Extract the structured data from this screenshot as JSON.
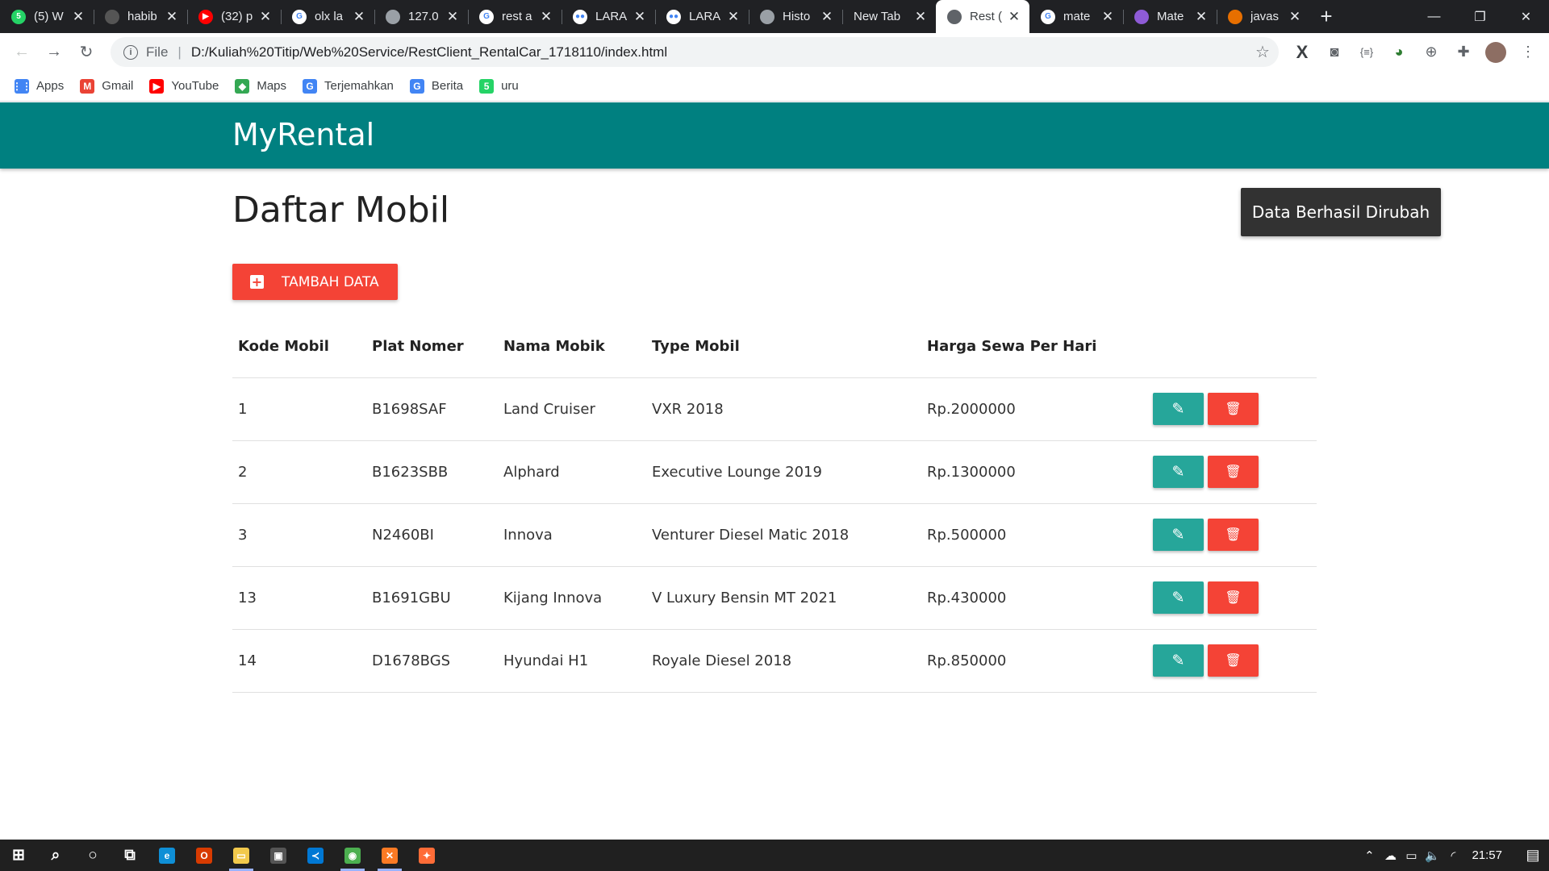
{
  "browser": {
    "tabs": [
      {
        "title": "(5) W",
        "favicon": "whatsapp-icon",
        "color": "#25d366",
        "glyph": "5",
        "active": false
      },
      {
        "title": "habib",
        "favicon": "github-icon",
        "color": "#555555",
        "glyph": "",
        "active": false
      },
      {
        "title": "(32) p",
        "favicon": "youtube-icon",
        "color": "#ff0000",
        "glyph": "▶",
        "active": false
      },
      {
        "title": "olx la",
        "favicon": "google-icon",
        "color": "#ffffff",
        "glyph": "G",
        "active": false
      },
      {
        "title": "127.0",
        "favicon": "globe-icon",
        "color": "#9aa0a6",
        "glyph": "",
        "active": false
      },
      {
        "title": "rest a",
        "favicon": "google-icon",
        "color": "#ffffff",
        "glyph": "G",
        "active": false
      },
      {
        "title": "LARA",
        "favicon": "medium-icon",
        "color": "#ffffff",
        "glyph": "●●",
        "active": false
      },
      {
        "title": "LARA",
        "favicon": "medium-icon",
        "color": "#ffffff",
        "glyph": "●●",
        "active": false
      },
      {
        "title": "Histo",
        "favicon": "history-icon",
        "color": "#9aa0a6",
        "glyph": "",
        "active": false
      },
      {
        "title": "New Tab",
        "favicon": "",
        "color": "",
        "glyph": "",
        "active": false
      },
      {
        "title": "Rest (",
        "favicon": "globe-icon",
        "color": "#5f6368",
        "glyph": "",
        "active": true
      },
      {
        "title": "mate",
        "favicon": "google-icon",
        "color": "#ffffff",
        "glyph": "G",
        "active": false
      },
      {
        "title": "Mate",
        "favicon": "materialize-icon",
        "color": "#8e5bd6",
        "glyph": "",
        "active": false
      },
      {
        "title": "javas",
        "favicon": "java-icon",
        "color": "#e76f00",
        "glyph": "",
        "active": false
      }
    ],
    "new_tab_glyph": "+",
    "window_controls": {
      "minimize": "—",
      "restore": "❐",
      "close": "✕"
    },
    "address": {
      "scheme": "File",
      "url": "D:/Kuliah%20Titip/Web%20Service/RestClient_RentalCar_1718110/index.html"
    },
    "bookmarks": [
      {
        "label": "Apps",
        "icon": "apps-grid-icon",
        "color": "#4285f4",
        "glyph": "⋮⋮"
      },
      {
        "label": "Gmail",
        "icon": "gmail-icon",
        "color": "#ea4335",
        "glyph": "M"
      },
      {
        "label": "YouTube",
        "icon": "youtube-icon",
        "color": "#ff0000",
        "glyph": "▶"
      },
      {
        "label": "Maps",
        "icon": "maps-icon",
        "color": "#34a853",
        "glyph": "◆"
      },
      {
        "label": "Terjemahkan",
        "icon": "translate-icon",
        "color": "#4285f4",
        "glyph": "G"
      },
      {
        "label": "Berita",
        "icon": "news-icon",
        "color": "#4285f4",
        "glyph": "G"
      },
      {
        "label": "uru",
        "icon": "whatsapp-icon",
        "color": "#25d366",
        "glyph": "5"
      }
    ]
  },
  "app": {
    "brand": "MyRental",
    "page_title": "Daftar Mobil",
    "toast": "Data Berhasil Dirubah",
    "add_button": "TAMBAH DATA",
    "accent": "#008080",
    "table": {
      "headers": [
        "Kode Mobil",
        "Plat Nomer",
        "Nama Mobik",
        "Type Mobil",
        "Harga Sewa Per Hari"
      ],
      "rows": [
        [
          "1",
          "B1698SAF",
          "Land Cruiser",
          "VXR 2018",
          "Rp.2000000"
        ],
        [
          "2",
          "B1623SBB",
          "Alphard",
          "Executive Lounge 2019",
          "Rp.1300000"
        ],
        [
          "3",
          "N2460BI",
          "Innova",
          "Venturer Diesel Matic 2018",
          "Rp.500000"
        ],
        [
          "13",
          "B1691GBU",
          "Kijang Innova",
          "V Luxury Bensin MT 2021",
          "Rp.430000"
        ],
        [
          "14",
          "D1678BGS",
          "Hyundai H1",
          "Royale Diesel 2018",
          "Rp.850000"
        ]
      ],
      "edit_glyph": "✎",
      "delete_glyph": "🗑"
    }
  },
  "taskbar": {
    "apps": [
      {
        "name": "windows-start-icon",
        "glyph": "⊞",
        "color": "",
        "active": false
      },
      {
        "name": "search-icon",
        "glyph": "⌕",
        "color": "",
        "active": false
      },
      {
        "name": "cortana-icon",
        "glyph": "○",
        "color": "",
        "active": false
      },
      {
        "name": "task-view-icon",
        "glyph": "⧉",
        "color": "",
        "active": false
      },
      {
        "name": "edge-icon",
        "glyph": "e",
        "color": "#0f8fd6",
        "active": false
      },
      {
        "name": "office-icon",
        "glyph": "O",
        "color": "#d83b01",
        "active": false
      },
      {
        "name": "file-explorer-icon",
        "glyph": "▭",
        "color": "#f2c94c",
        "active": true
      },
      {
        "name": "store-icon",
        "glyph": "▣",
        "color": "#555555",
        "active": false
      },
      {
        "name": "vscode-icon",
        "glyph": "≺",
        "color": "#0078d4",
        "active": false
      },
      {
        "name": "chrome-icon",
        "glyph": "◉",
        "color": "#4caf50",
        "active": true
      },
      {
        "name": "xampp-icon",
        "glyph": "✕",
        "color": "#fb7a24",
        "active": true
      },
      {
        "name": "postman-icon",
        "glyph": "✦",
        "color": "#ff6c37",
        "active": false
      }
    ],
    "tray": [
      "chevron-up-icon",
      "onedrive-icon",
      "battery-icon",
      "volume-icon",
      "wifi-icon"
    ],
    "clock": "21:57"
  }
}
